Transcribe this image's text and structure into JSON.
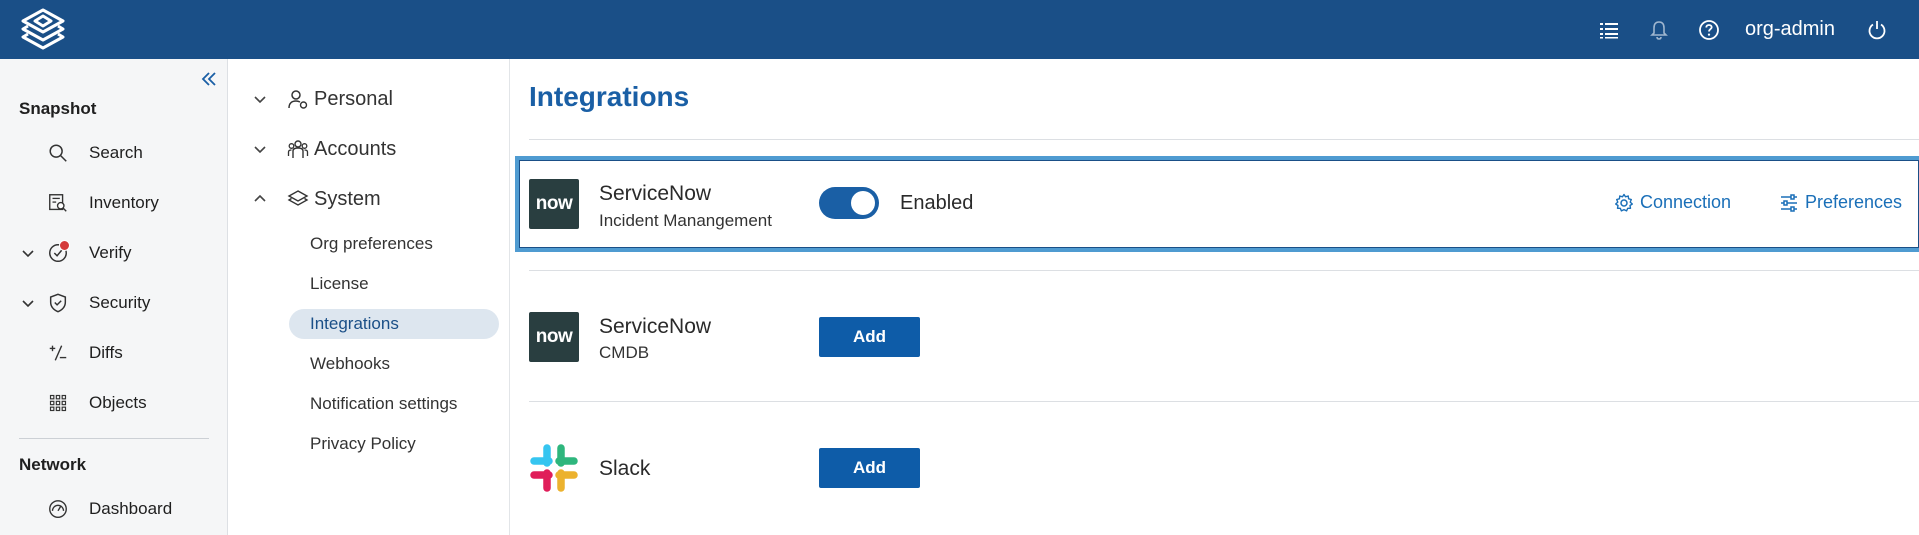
{
  "header": {
    "user": "org-admin",
    "icons": [
      "list-icon",
      "bell-icon",
      "help-icon",
      "power-icon"
    ]
  },
  "sidebar": {
    "sections": [
      {
        "title": "Snapshot"
      },
      {
        "title": "Network"
      }
    ],
    "items": [
      {
        "label": "Search",
        "icon": "search-icon"
      },
      {
        "label": "Inventory",
        "icon": "inventory-icon"
      },
      {
        "label": "Verify",
        "icon": "verify-icon"
      },
      {
        "label": "Security",
        "icon": "shield-icon"
      },
      {
        "label": "Diffs",
        "icon": "diffs-icon"
      },
      {
        "label": "Objects",
        "icon": "grid-icon"
      },
      {
        "label": "Dashboard",
        "icon": "dashboard-icon"
      }
    ]
  },
  "settings": {
    "groups": [
      {
        "label": "Personal",
        "icon": "person-settings-icon"
      },
      {
        "label": "Accounts",
        "icon": "accounts-icon"
      },
      {
        "label": "System",
        "icon": "layers-icon"
      }
    ],
    "system_items": [
      {
        "label": "Org preferences"
      },
      {
        "label": "License"
      },
      {
        "label": "Integrations"
      },
      {
        "label": "Webhooks"
      },
      {
        "label": "Notification settings"
      },
      {
        "label": "Privacy Policy"
      }
    ]
  },
  "main": {
    "title": "Integrations",
    "integrations": [
      {
        "name": "ServiceNow",
        "subtitle": "Incident Manangement",
        "logo_text": "now",
        "status": "Enabled",
        "actions": [
          "Connection",
          "Preferences"
        ]
      },
      {
        "name": "ServiceNow",
        "subtitle": "CMDB",
        "logo_text": "now",
        "button": "Add"
      },
      {
        "name": "Slack",
        "button": "Add"
      }
    ]
  },
  "colors": {
    "topbar": "#1a4f87",
    "accent": "#1a5fa5",
    "highlight": "#4f9bd1"
  }
}
